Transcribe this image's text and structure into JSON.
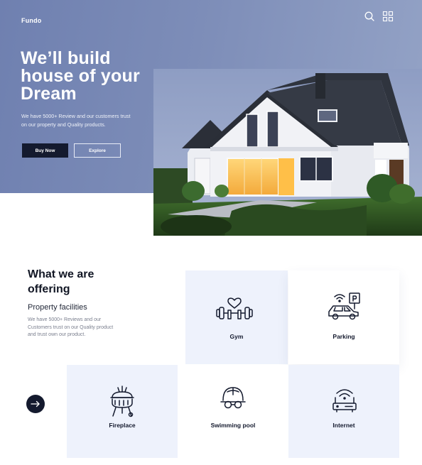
{
  "header": {
    "brand": "Fundo",
    "icons": [
      "search-icon",
      "grid-menu-icon"
    ]
  },
  "hero": {
    "title_lines": [
      "We’ll build",
      "house of your",
      "Dream"
    ],
    "subtitle_lines": [
      "We have 5000+ Review and our customers trust",
      "on our property and Quality products."
    ],
    "buy_label": "Buy Now",
    "explore_label": "Explore"
  },
  "offering": {
    "title_lines": [
      "What we are",
      "offering"
    ],
    "subtitle": "Property facilities",
    "description_lines": [
      "We have 5000+ Reviews and our",
      "Customers trust on our Quality product",
      "and trust own our product."
    ],
    "next_icon": "arrow-right-icon"
  },
  "facilities": [
    {
      "label": "Gym",
      "icon": "gym-icon"
    },
    {
      "label": "Parking",
      "icon": "parking-icon"
    },
    {
      "label": "Fireplace",
      "icon": "fireplace-icon"
    },
    {
      "label": "Swimming pool",
      "icon": "swimming-pool-icon"
    },
    {
      "label": "Internet",
      "icon": "internet-router-icon"
    }
  ],
  "colors": {
    "hero_bg": "#7d8db8",
    "dark": "#141a2e",
    "card_blue": "#eef2fc"
  }
}
